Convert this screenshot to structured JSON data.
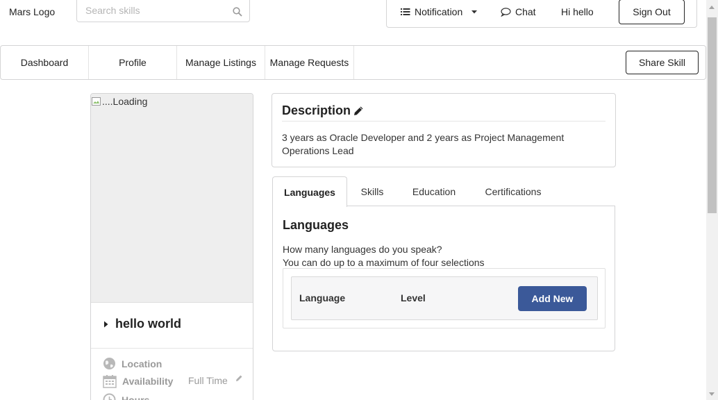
{
  "header": {
    "logo_text": "Mars Logo",
    "search_placeholder": "Search skills",
    "notification_label": "Notification",
    "chat_label": "Chat",
    "greeting": "Hi hello",
    "signout_label": "Sign Out"
  },
  "nav": {
    "items": [
      {
        "label": "Dashboard"
      },
      {
        "label": "Profile"
      },
      {
        "label": "Manage Listings"
      },
      {
        "label": "Manage Requests"
      }
    ],
    "share_label": "Share Skill"
  },
  "profile_card": {
    "image_alt": "....Loading",
    "name": "hello world",
    "location_label": "Location",
    "availability_label": "Availability",
    "availability_value": "Full Time",
    "hours_label": "Hours"
  },
  "description": {
    "title": "Description",
    "text": "3 years as Oracle Developer and 2 years as Project Management Operations Lead"
  },
  "tabs": {
    "items": [
      {
        "label": "Languages"
      },
      {
        "label": "Skills"
      },
      {
        "label": "Education"
      },
      {
        "label": "Certifications"
      }
    ],
    "active": "Languages"
  },
  "languages_panel": {
    "title": "Languages",
    "question": "How many languages do you speak?",
    "hint": "You can do up to a maximum of four selections",
    "columns": [
      "Language",
      "Level"
    ],
    "add_label": "Add New"
  },
  "colors": {
    "primary_button": "#3b5999",
    "border": "#d4d4d5",
    "image_placeholder": "#eeeeee"
  }
}
